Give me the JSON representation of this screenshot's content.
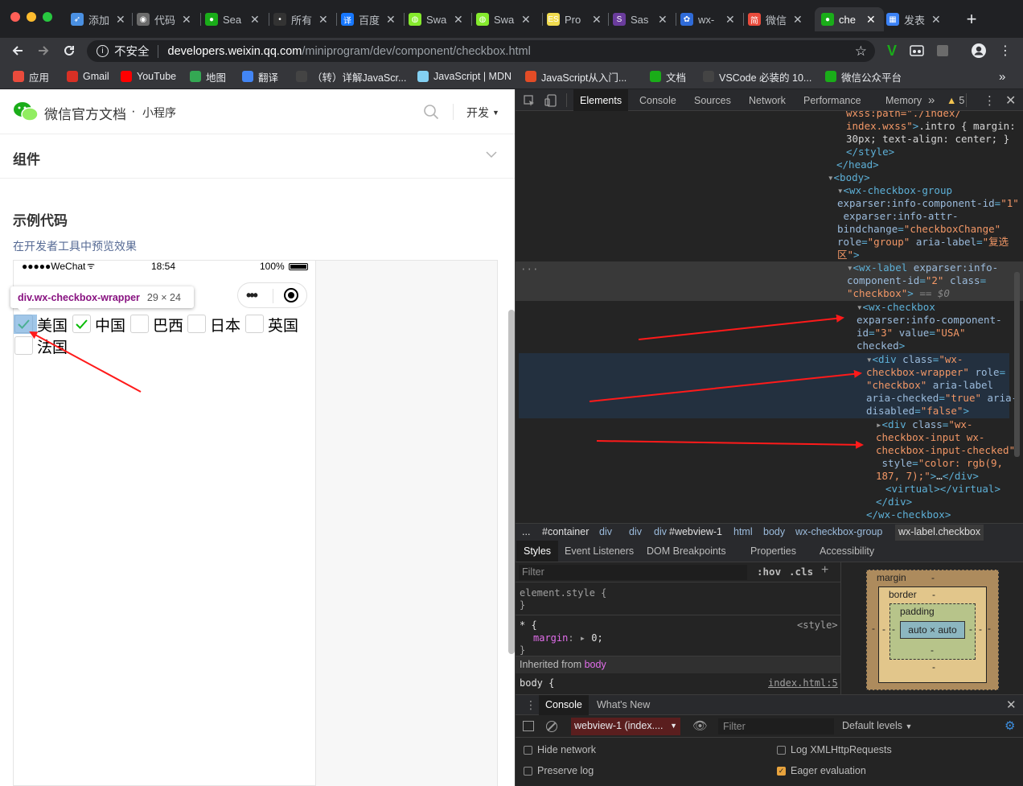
{
  "browser": {
    "tabs": [
      {
        "label": "添加",
        "icon": "rocket-icon",
        "color": "#4a90e2"
      },
      {
        "label": "代码",
        "icon": "eye-icon",
        "color": "#6b6b6b"
      },
      {
        "label": "Sea",
        "icon": "wechat-icon",
        "color": "#1aad19"
      },
      {
        "label": "所有",
        "icon": "dot-icon",
        "color": "#333"
      },
      {
        "label": "百度",
        "icon": "translate-icon",
        "color": "#1677ff"
      },
      {
        "label": "Swa",
        "icon": "swagger-icon",
        "color": "#85ea2d"
      },
      {
        "label": "Swa",
        "icon": "swagger-icon",
        "color": "#85ea2d"
      },
      {
        "label": "Pro",
        "icon": "es-icon",
        "color": "#f0db4f"
      },
      {
        "label": "Sas",
        "icon": "s-icon",
        "color": "#6a3c9c"
      },
      {
        "label": "wx-",
        "icon": "paw-icon",
        "color": "#2f6bd8"
      },
      {
        "label": "微信",
        "icon": "jian-icon",
        "color": "#e94b3c"
      },
      {
        "label": "che",
        "icon": "wechat-icon",
        "color": "#1aad19",
        "active": true
      },
      {
        "label": "发表",
        "icon": "grid-icon",
        "color": "#3b82f6"
      }
    ],
    "security_label": "不安全",
    "url_host": "developers.weixin.qq.com",
    "url_path": "/miniprogram/dev/component/checkbox.html",
    "bookmarks": [
      {
        "label": "应用",
        "icon": "apps-icon",
        "color": "#e94b3c"
      },
      {
        "label": "Gmail",
        "icon": "gmail-icon",
        "color": "#d93025"
      },
      {
        "label": "YouTube",
        "icon": "youtube-icon",
        "color": "#ff0000"
      },
      {
        "label": "地图",
        "icon": "maps-icon",
        "color": "#34a853"
      },
      {
        "label": "翻译",
        "icon": "translate-icon",
        "color": "#4285f4"
      },
      {
        "label": "（转）详解JavaScr...",
        "icon": "page-icon",
        "color": "#444"
      },
      {
        "label": "JavaScript | MDN",
        "icon": "mdn-icon",
        "color": "#83d0f2"
      },
      {
        "label": "JavaScript从入门...",
        "icon": "html-icon",
        "color": "#e34c26"
      },
      {
        "label": "文档",
        "icon": "wechat-icon",
        "color": "#1aad19"
      },
      {
        "label": "VSCode 必装的 10...",
        "icon": "page-icon",
        "color": "#444"
      },
      {
        "label": "微信公众平台",
        "icon": "wechat-icon",
        "color": "#1aad19"
      }
    ]
  },
  "site": {
    "logo_text": "微信官方文档",
    "logo_sub": "小程序",
    "nav_dev": "开发",
    "section_title": "组件",
    "example_title": "示例代码",
    "preview_link": "在开发者工具中预览效果",
    "accent_color": "#1aad19"
  },
  "phone": {
    "carrier": "●●●●●WeChat",
    "time": "18:54",
    "battery": "100%",
    "tooltip_name": "div.wx-checkbox-wrapper",
    "tooltip_size": "29 × 24",
    "checkboxes": [
      {
        "label": "美国",
        "checked": true
      },
      {
        "label": "中国",
        "checked": true
      },
      {
        "label": "巴西",
        "checked": false
      },
      {
        "label": "日本",
        "checked": false
      },
      {
        "label": "英国",
        "checked": false
      },
      {
        "label": "法国",
        "checked": false
      }
    ]
  },
  "devtools": {
    "tabs": [
      "Elements",
      "Console",
      "Sources",
      "Network",
      "Performance",
      "Memory"
    ],
    "warning_count": "5",
    "breadcrumbs": [
      "...",
      "#container",
      "div",
      "div",
      "div",
      "#webview-1",
      "html",
      "body",
      "wx-checkbox-group",
      "wx-label.checkbox"
    ],
    "panel_tabs": [
      "Styles",
      "Event Listeners",
      "DOM Breakpoints",
      "Properties",
      "Accessibility"
    ],
    "filter_placeholder": "Filter",
    "hov": ":hov",
    "cls": ".cls",
    "element_style": "element.style {",
    "close_brace": "}",
    "star_rule": "* {",
    "style_source": "<style>",
    "margin_prop": "margin",
    "margin_val": "0;",
    "inherited_from": "Inherited from",
    "inherited_tag": "body",
    "body_rule": "body {",
    "body_source": "index.html:5",
    "box_margin": "margin",
    "box_border": "border",
    "box_padding": "padding",
    "box_content": "auto × auto",
    "box_dash": "-",
    "drawer_tabs": [
      "Console",
      "What's New"
    ],
    "context": "webview-1 (index....",
    "console_filter": "Filter",
    "levels": "Default levels",
    "options": [
      {
        "label": "Hide network",
        "checked": false
      },
      {
        "label": "Log XMLHttpRequests",
        "checked": false
      },
      {
        "label": "Preserve log",
        "checked": false
      },
      {
        "label": "Eager evaluation",
        "checked": true
      }
    ]
  }
}
